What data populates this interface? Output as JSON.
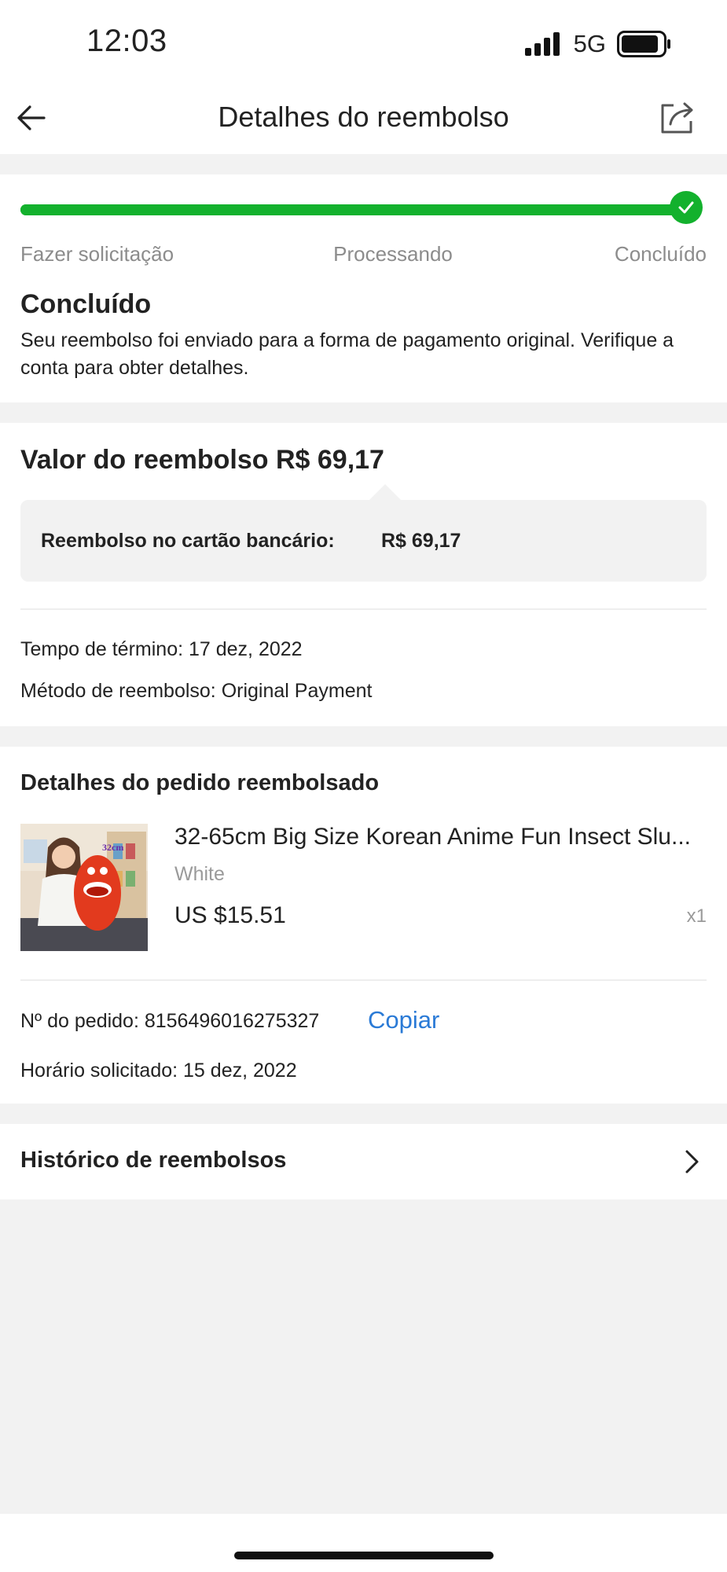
{
  "status_bar": {
    "time": "12:03",
    "network": "5G",
    "signal_icon": "signal-bars-icon",
    "battery_icon": "battery-icon"
  },
  "header": {
    "title": "Detalhes do reembolso",
    "back_icon": "arrow-left-icon",
    "share_icon": "share-icon"
  },
  "progress": {
    "steps": [
      "Fazer solicitação",
      "Processando",
      "Concluído"
    ],
    "current_step": 3,
    "completion": 1.0,
    "accent_color": "#13b12d"
  },
  "status": {
    "title": "Concluído",
    "description": "Seu reembolso foi enviado para a forma de pagamento original. Verifique a conta para obter detalhes."
  },
  "refund": {
    "amount_title": "Valor do reembolso R$ 69,17",
    "box_label": "Reembolso no cartão bancário:",
    "box_value": "R$ 69,17",
    "end_time": "Tempo de término: 17 dez, 2022",
    "method": "Método de reembolso: Original Payment"
  },
  "order": {
    "title": "Detalhes do pedido reembolsado",
    "product": {
      "name": "32-65cm Big Size Korean Anime Fun Insect Slu...",
      "variant": "White",
      "price": "US $15.51",
      "quantity": "x1",
      "image_text": "32cm"
    },
    "order_number": "Nº do pedido: 8156496016275327",
    "copy_label": "Copiar",
    "requested_time": "Horário solicitado: 15 dez, 2022"
  },
  "history": {
    "label": "Histórico de reembolsos",
    "chevron_icon": "chevron-right-icon"
  },
  "colors": {
    "link": "#2a7ad6",
    "success": "#13b12d",
    "background": "#f2f2f2"
  }
}
